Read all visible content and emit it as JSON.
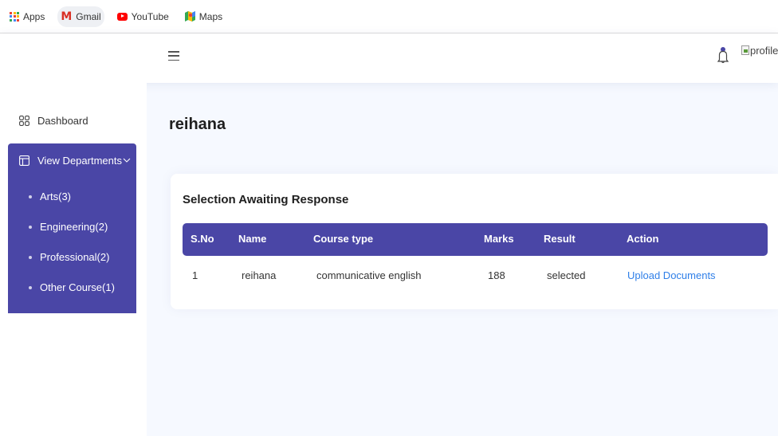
{
  "bookmarks": [
    {
      "label": "Apps",
      "icon": "apps-grid-icon"
    },
    {
      "label": "Gmail",
      "icon": "gmail-icon"
    },
    {
      "label": "YouTube",
      "icon": "youtube-icon"
    },
    {
      "label": "Maps",
      "icon": "maps-icon"
    }
  ],
  "header": {
    "menu_icon": "hamburger-icon",
    "bell_icon": "bell-icon",
    "profile_alt": "profile"
  },
  "sidebar": {
    "dashboard_label": "Dashboard",
    "departments_label": "View Departments",
    "departments": [
      {
        "label": "Arts(3)"
      },
      {
        "label": "Engineering(2)"
      },
      {
        "label": "Professional(2)"
      },
      {
        "label": "Other Course(1)"
      }
    ]
  },
  "main": {
    "page_title": "reihana",
    "card_title": "Selection Awaiting Response",
    "table": {
      "headers": [
        "S.No",
        "Name",
        "Course type",
        "Marks",
        "Result",
        "Action"
      ],
      "rows": [
        [
          "1",
          "reihana",
          "communicative english",
          "188",
          "selected",
          "Upload Documents"
        ]
      ]
    }
  },
  "colors": {
    "accent": "#4a46a6",
    "link": "#2f7fe8",
    "background": "#f6f9ff"
  }
}
